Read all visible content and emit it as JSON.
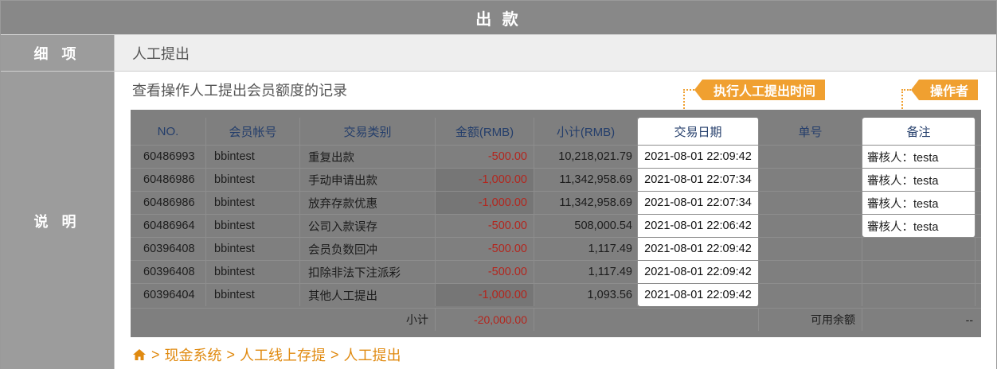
{
  "header": {
    "title": "出 款"
  },
  "detail": {
    "label": "细 项",
    "value": "人工提出"
  },
  "explain": {
    "label": "说 明",
    "description": "查看操作人工提出会员额度的记录",
    "tag_date": "执行人工提出时间",
    "tag_operator": "操作者"
  },
  "table": {
    "headers": {
      "no": "NO.",
      "account": "会员帐号",
      "type": "交易类别",
      "amount": "金额(RMB)",
      "subtotal": "小计(RMB)",
      "date": "交易日期",
      "number": "单号",
      "memo": "备注"
    },
    "rows": [
      {
        "no": "60486993",
        "account": "bbintest",
        "type": "重复出款",
        "amount": "-500.00",
        "subtotal": "10,218,021.79",
        "date": "2021-08-01 22:09:42",
        "memo": "審核人：testa"
      },
      {
        "no": "60486986",
        "account": "bbintest",
        "type": "手动申请出款",
        "amount": "-1,000.00",
        "subtotal": "11,342,958.69",
        "date": "2021-08-01 22:07:34",
        "memo": "審核人：testa"
      },
      {
        "no": "60486986",
        "account": "bbintest",
        "type": "放弃存款优惠",
        "amount": "-1,000.00",
        "subtotal": "11,342,958.69",
        "date": "2021-08-01 22:07:34",
        "memo": "審核人：testa"
      },
      {
        "no": "60486964",
        "account": "bbintest",
        "type": "公司入款误存",
        "amount": "-500.00",
        "subtotal": "508,000.54",
        "date": "2021-08-01 22:06:42",
        "memo": "審核人：testa"
      },
      {
        "no": "60396408",
        "account": "bbintest",
        "type": "会员负数回冲",
        "amount": "-500.00",
        "subtotal": "1,117.49",
        "date": "2021-08-01 22:09:42",
        "memo": ""
      },
      {
        "no": "60396408",
        "account": "bbintest",
        "type": "扣除非法下注派彩",
        "amount": "-500.00",
        "subtotal": "1,117.49",
        "date": "2021-08-01 22:09:42",
        "memo": ""
      },
      {
        "no": "60396404",
        "account": "bbintest",
        "type": "其他人工提出",
        "amount": "-1,000.00",
        "subtotal": "1,093.56",
        "date": "2021-08-01 22:09:42",
        "memo": ""
      }
    ],
    "footer": {
      "subtotal_label": "小计",
      "subtotal_amount": "-20,000.00",
      "available_label": "可用余额",
      "available_value": "--"
    }
  },
  "breadcrumb": {
    "items": [
      "现金系统",
      "人工线上存提",
      "人工提出"
    ],
    "separator": ">"
  }
}
